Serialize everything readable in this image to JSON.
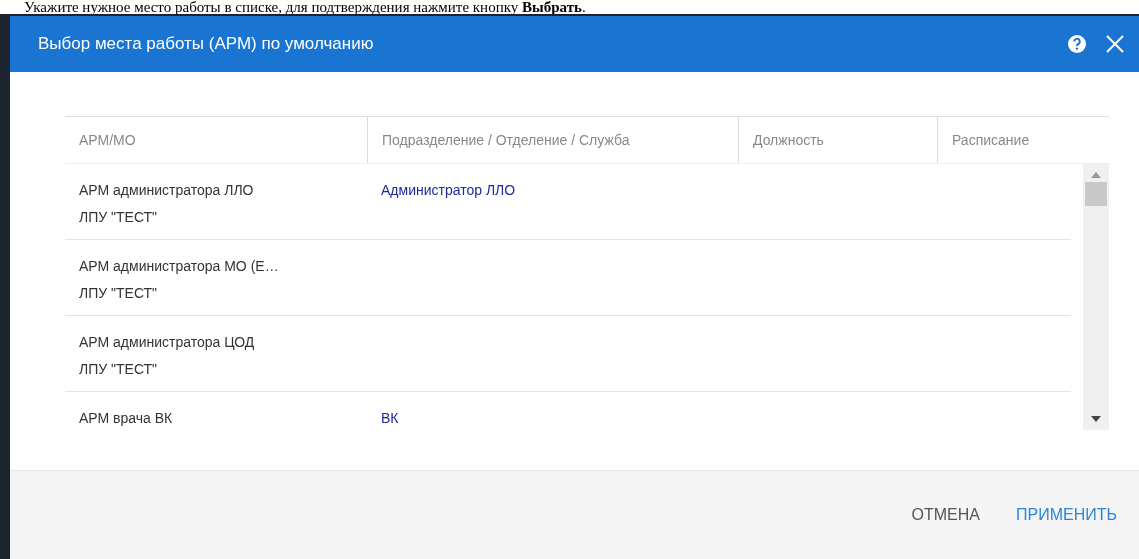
{
  "instruction": "Укажите нужное место работы в списке, для подтверждения нажмите кнопку **Выбрать**.",
  "dialog": {
    "title": "Выбор места работы (АРМ) по умолчанию"
  },
  "table": {
    "columns": [
      "АРМ/МО",
      "Подразделение / Отделение / Служба",
      "Должность",
      "Расписание"
    ],
    "rows": [
      {
        "workplace": "АРМ администратора ЛЛО",
        "organization": "ЛПУ \"ТЕСТ\"",
        "department": "Администратор ЛЛО"
      },
      {
        "workplace": "АРМ администратора МО (Е…",
        "organization": "ЛПУ \"ТЕСТ\"",
        "department": ""
      },
      {
        "workplace": "АРМ администратора ЦОД",
        "organization": "ЛПУ \"ТЕСТ\"",
        "department": ""
      },
      {
        "workplace": "АРМ врача ВК",
        "department": "ВК"
      }
    ]
  },
  "buttons": [
    {
      "label": "ОТМЕНА",
      "kind": "secondary"
    },
    {
      "label": "ПРИМЕНИТЬ",
      "kind": "primary"
    }
  ]
}
